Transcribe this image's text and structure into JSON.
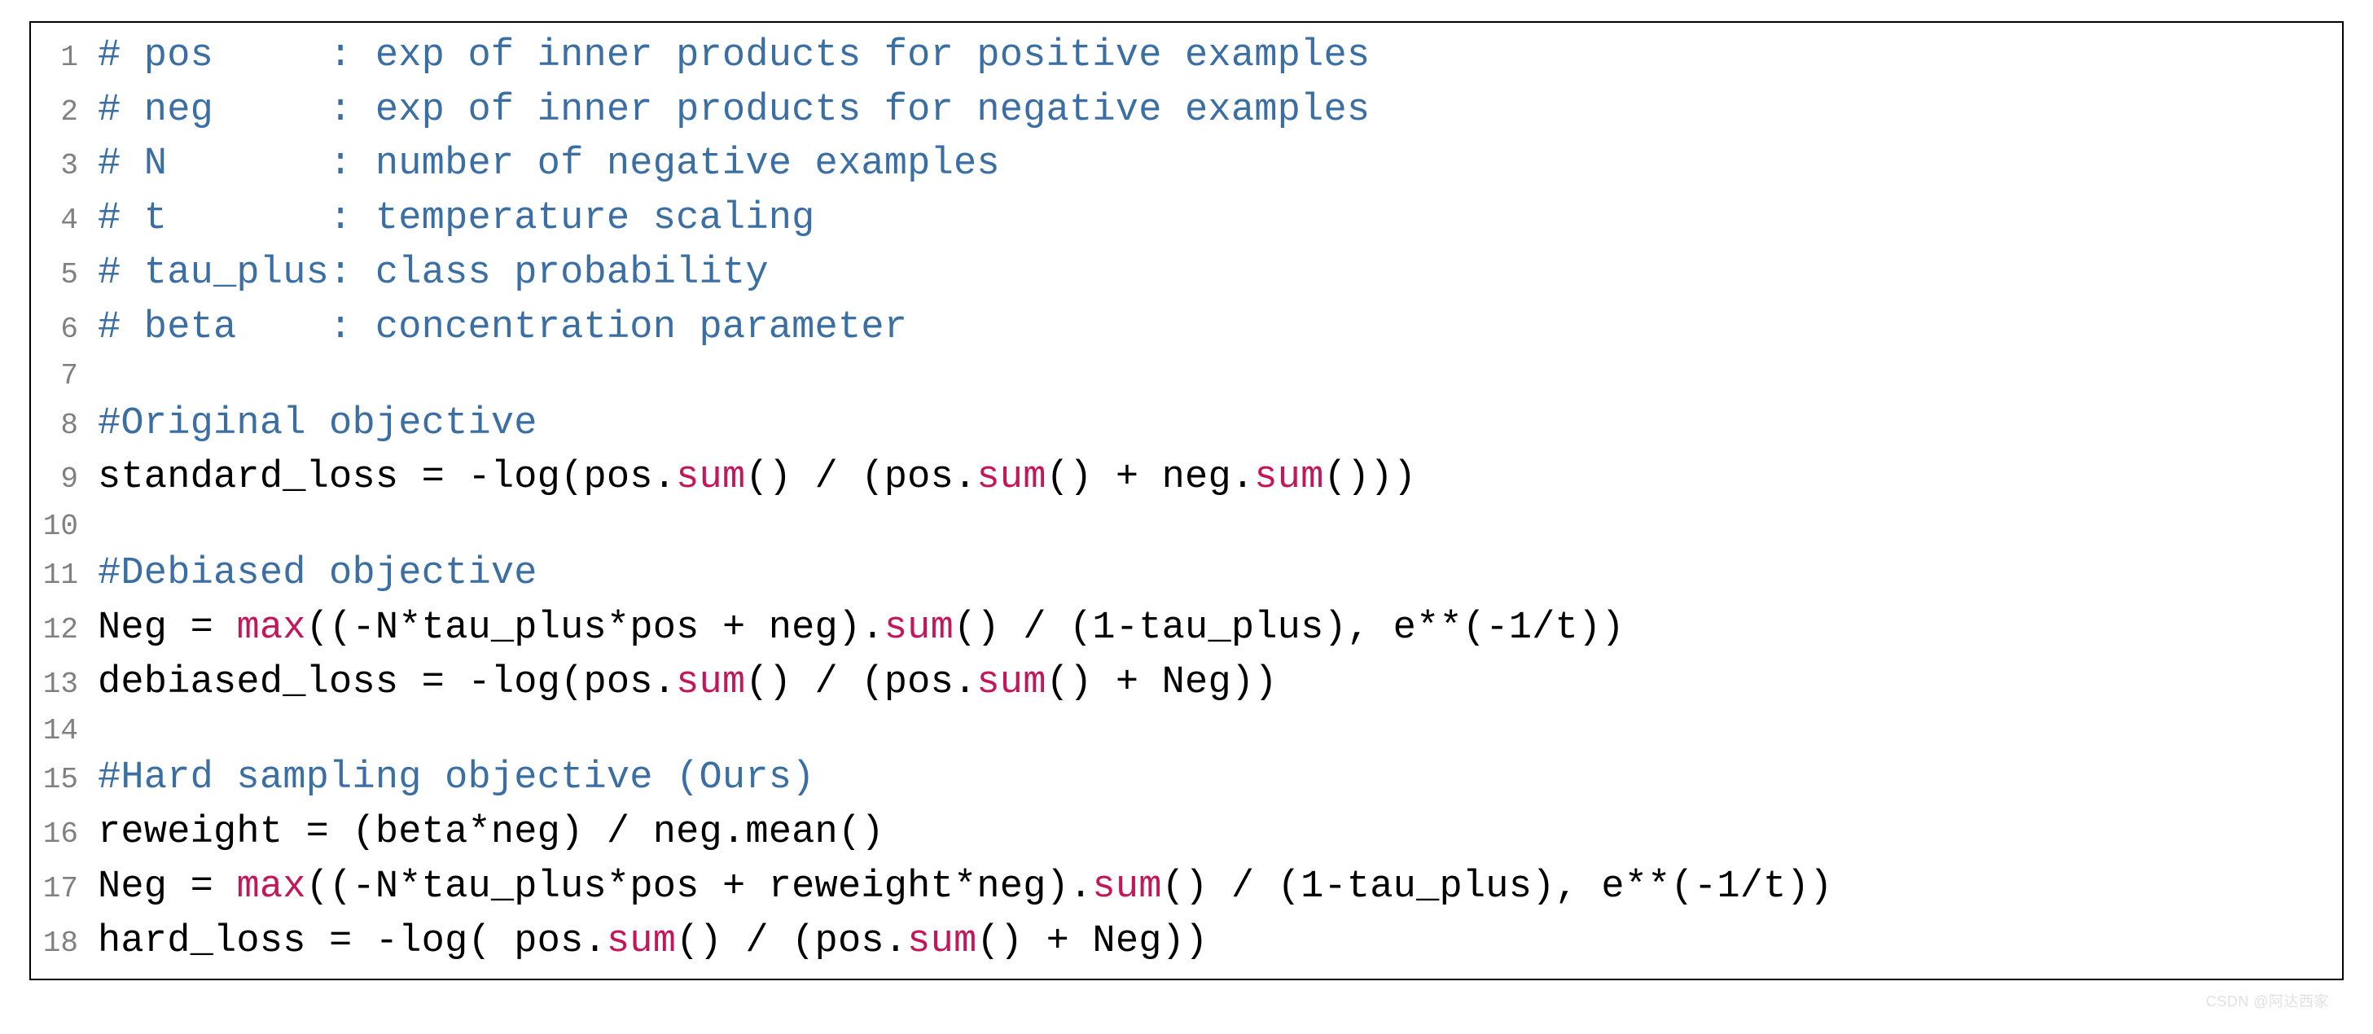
{
  "lines": [
    {
      "n": "1",
      "segs": [
        {
          "t": "# pos     : exp of inner products for positive examples",
          "c": "cm"
        }
      ]
    },
    {
      "n": "2",
      "segs": [
        {
          "t": "# neg     : exp of inner products for negative examples",
          "c": "cm"
        }
      ]
    },
    {
      "n": "3",
      "segs": [
        {
          "t": "# N       : number of negative examples",
          "c": "cm"
        }
      ]
    },
    {
      "n": "4",
      "segs": [
        {
          "t": "# t       : temperature scaling",
          "c": "cm"
        }
      ]
    },
    {
      "n": "5",
      "segs": [
        {
          "t": "# tau_plus: class probability",
          "c": "cm"
        }
      ]
    },
    {
      "n": "6",
      "segs": [
        {
          "t": "# beta    : concentration parameter",
          "c": "cm"
        }
      ]
    },
    {
      "n": "7",
      "segs": [
        {
          "t": "",
          "c": ""
        }
      ]
    },
    {
      "n": "8",
      "segs": [
        {
          "t": "#Original objective",
          "c": "cm"
        }
      ]
    },
    {
      "n": "9",
      "segs": [
        {
          "t": "standard_loss = -log(pos.",
          "c": ""
        },
        {
          "t": "sum",
          "c": "pk"
        },
        {
          "t": "() / (pos.",
          "c": ""
        },
        {
          "t": "sum",
          "c": "pk"
        },
        {
          "t": "() + neg.",
          "c": ""
        },
        {
          "t": "sum",
          "c": "pk"
        },
        {
          "t": "()))",
          "c": ""
        }
      ]
    },
    {
      "n": "10",
      "segs": [
        {
          "t": "",
          "c": ""
        }
      ]
    },
    {
      "n": "11",
      "segs": [
        {
          "t": "#Debiased objective",
          "c": "cm"
        }
      ]
    },
    {
      "n": "12",
      "segs": [
        {
          "t": "Neg = ",
          "c": ""
        },
        {
          "t": "max",
          "c": "pk"
        },
        {
          "t": "((-N*tau_plus*pos + neg).",
          "c": ""
        },
        {
          "t": "sum",
          "c": "pk"
        },
        {
          "t": "() / (1-tau_plus), e**(-1/t))",
          "c": ""
        }
      ]
    },
    {
      "n": "13",
      "segs": [
        {
          "t": "debiased_loss = -log(pos.",
          "c": ""
        },
        {
          "t": "sum",
          "c": "pk"
        },
        {
          "t": "() / (pos.",
          "c": ""
        },
        {
          "t": "sum",
          "c": "pk"
        },
        {
          "t": "() + Neg))",
          "c": ""
        }
      ]
    },
    {
      "n": "14",
      "segs": [
        {
          "t": "",
          "c": ""
        }
      ]
    },
    {
      "n": "15",
      "segs": [
        {
          "t": "#Hard sampling objective (Ours)",
          "c": "cm"
        }
      ]
    },
    {
      "n": "16",
      "segs": [
        {
          "t": "reweight = (beta*neg) / neg.mean()",
          "c": ""
        }
      ]
    },
    {
      "n": "17",
      "segs": [
        {
          "t": "Neg = ",
          "c": ""
        },
        {
          "t": "max",
          "c": "pk"
        },
        {
          "t": "((-N*tau_plus*pos + reweight*neg).",
          "c": ""
        },
        {
          "t": "sum",
          "c": "pk"
        },
        {
          "t": "() / (1-tau_plus), e**(-1/t))",
          "c": ""
        }
      ]
    },
    {
      "n": "18",
      "segs": [
        {
          "t": "hard_loss = -log( pos.",
          "c": ""
        },
        {
          "t": "sum",
          "c": "pk"
        },
        {
          "t": "() / (pos.",
          "c": ""
        },
        {
          "t": "sum",
          "c": "pk"
        },
        {
          "t": "() + Neg))",
          "c": ""
        }
      ]
    }
  ],
  "watermark": "CSDN @阿达西家"
}
